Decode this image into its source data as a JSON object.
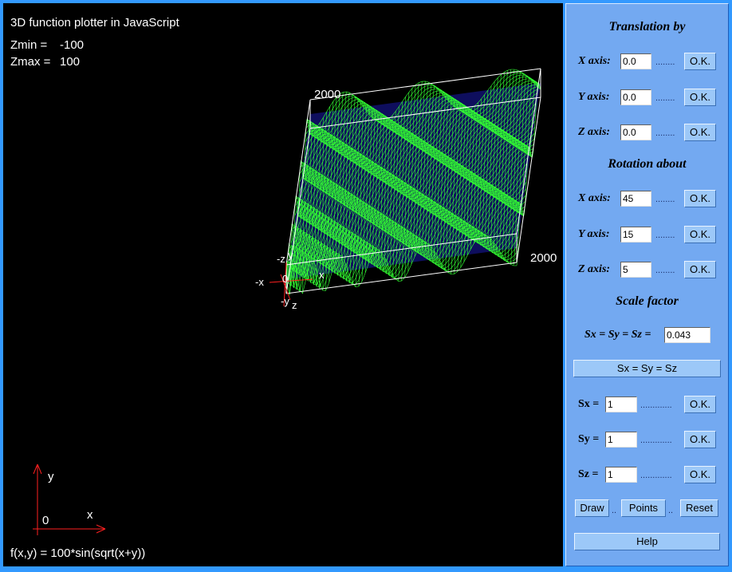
{
  "plot": {
    "title": "3D function plotter in JavaScript",
    "zmin_label": "Zmin =",
    "zmin_value": "-100",
    "zmax_label": "Zmax =",
    "zmax_value": "100",
    "formula": "f(x,y) = 100*sin(sqrt(x+y))",
    "tick_top": "2000",
    "tick_right": "2000",
    "axis_labels": {
      "neg_z_top": "-z",
      "y_top": "y",
      "neg_x": "-x",
      "origin": "0",
      "x": "x",
      "neg_y": "-y",
      "z": "z"
    },
    "legend_axes": {
      "y": "y",
      "origin": "0",
      "x": "x"
    },
    "colors": {
      "background": "#000000",
      "mesh": "#33ff33",
      "mesh_back": "#1a1aaa",
      "box": "#ffffff",
      "axis": "#ff2020",
      "text": "#ffffff"
    }
  },
  "panel": {
    "translation": {
      "title": "Translation by",
      "x_label": "X axis:",
      "x_value": "0.0",
      "y_label": "Y axis:",
      "y_value": "0.0",
      "z_label": "Z axis:",
      "z_value": "0.0"
    },
    "rotation": {
      "title": "Rotation about",
      "x_label": "X axis:",
      "x_value": "45",
      "y_label": "Y axis:",
      "y_value": "15",
      "z_label": "Z axis:",
      "z_value": "5"
    },
    "scale": {
      "title": "Scale factor",
      "uniform_label": "Sx = Sy = Sz =",
      "uniform_value": "0.043",
      "uniform_button": "Sx = Sy = Sz",
      "sx_label": "Sx =",
      "sx_value": "1",
      "sy_label": "Sy =",
      "sy_value": "1",
      "sz_label": "Sz =",
      "sz_value": "1"
    },
    "dots_short": "........",
    "dots_long": ".............",
    "dots_tiny": "..",
    "ok_label": "O.K.",
    "draw_label": "Draw",
    "points_label": "Points",
    "reset_label": "Reset",
    "help_label": "Help",
    "colors": {
      "page_border": "#3399ff",
      "panel": "#73a9f1",
      "button": "#9cc8f8"
    }
  }
}
